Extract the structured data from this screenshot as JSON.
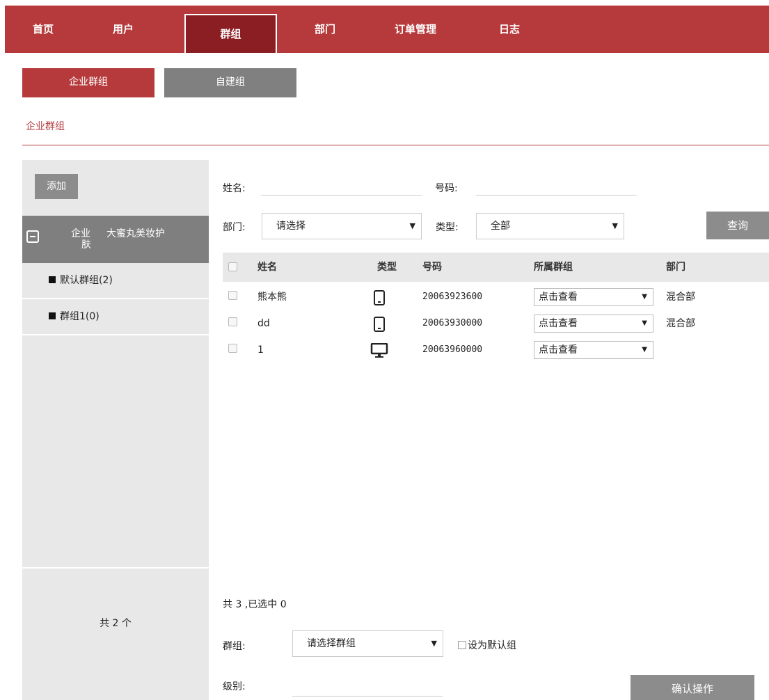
{
  "nav": {
    "tabs": [
      {
        "label": "首页"
      },
      {
        "label": "用户"
      },
      {
        "label": "群组"
      },
      {
        "label": "部门"
      },
      {
        "label": "订单管理"
      },
      {
        "label": "日志"
      }
    ],
    "active_index": 2
  },
  "subtabs": [
    "企业群组",
    "自建组"
  ],
  "breadcrumb": "企业群组",
  "sidebar": {
    "add_label": "添加",
    "org": {
      "line1": "企业",
      "line2": "肤",
      "name": "大蜜丸美妆护"
    },
    "groups": [
      {
        "label": "默认群组(2)"
      },
      {
        "label": "群组1(0)"
      }
    ],
    "count": "共 2 个"
  },
  "filters": {
    "name_label": "姓名:",
    "number_label": "号码:",
    "dept_label": "部门:",
    "dept_value": "请选择",
    "type_label": "类型:",
    "type_value": "全部",
    "query_label": "查询"
  },
  "table": {
    "headers": [
      "姓名",
      "类型",
      "号码",
      "所属群组",
      "部门"
    ],
    "rows": [
      {
        "name": "熊本熊",
        "type_icon": "mobile-icon",
        "number": "20063923600",
        "group": "点击查看",
        "dept": "混合部"
      },
      {
        "name": "dd",
        "type_icon": "mobile-icon",
        "number": "20063930000",
        "group": "点击查看",
        "dept": "混合部"
      },
      {
        "name": "1",
        "type_icon": "desktop-icon",
        "number": "20063960000",
        "group": "点击查看",
        "dept": ""
      }
    ]
  },
  "footer": {
    "summary": "共 3 ,已选中 0",
    "group_label": "群组:",
    "group_value": "请选择群组",
    "default_label": "设为默认组",
    "level_label": "级别:",
    "confirm_label": "确认操作"
  },
  "colors": {
    "brand": "#b63a3c",
    "brand_dark": "#8b1e22",
    "gray_button": "#8c8c8c"
  }
}
